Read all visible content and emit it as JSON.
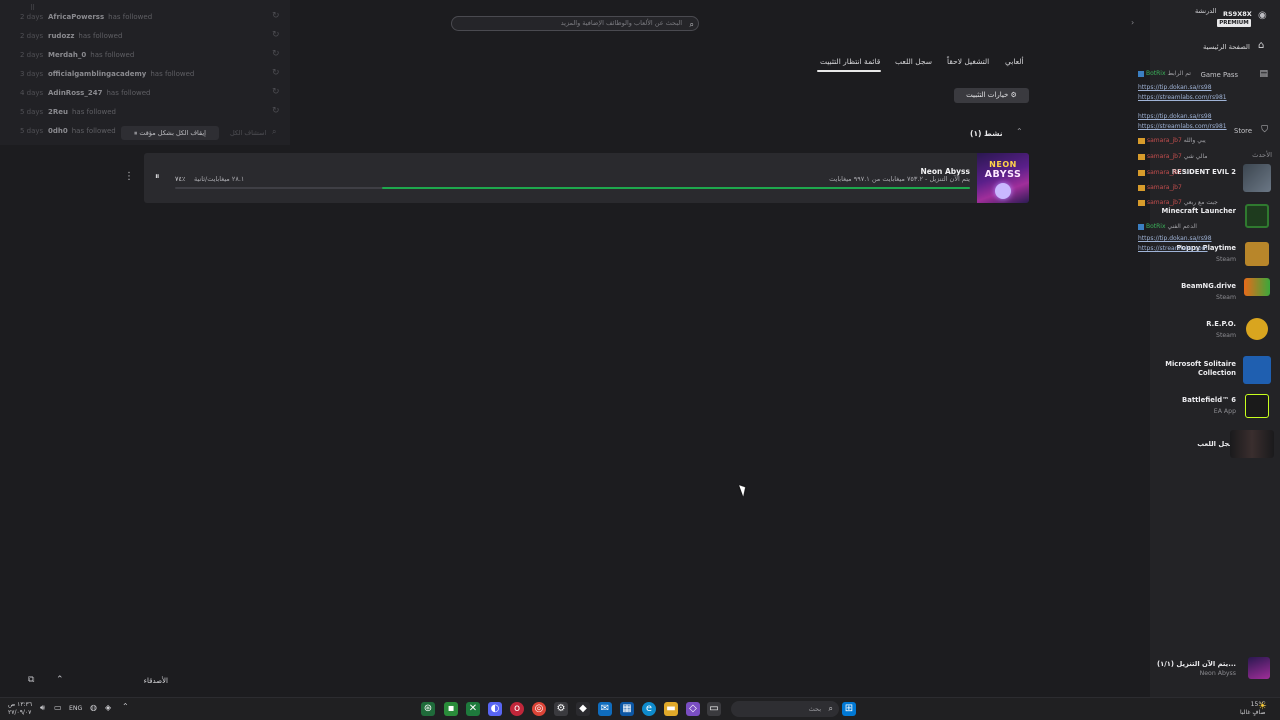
{
  "followers": {
    "rows": [
      {
        "ago": "2 days",
        "name": "AfricaPowerss",
        "action": "has followed"
      },
      {
        "ago": "2 days",
        "name": "rudozz",
        "action": "has followed"
      },
      {
        "ago": "2 days",
        "name": "Merdah_0",
        "action": "has followed"
      },
      {
        "ago": "3 days",
        "name": "officialgamblingacademy",
        "action": "has followed"
      },
      {
        "ago": "4 days",
        "name": "AdinRoss_247",
        "action": "has followed"
      },
      {
        "ago": "5 days",
        "name": "2Reu",
        "action": "has followed"
      },
      {
        "ago": "5 days",
        "name": "0dh0",
        "action": "has followed"
      }
    ],
    "pause_all": "⏸ إيقاف الكل بشكل مؤقت",
    "resume_all": "استئناف الكل"
  },
  "search": {
    "placeholder": "البحث عن الألعاب والوظائف الإضافية والمزيد"
  },
  "tabs": [
    {
      "label": "ألعابي"
    },
    {
      "label": "التشغيل لاحقاً"
    },
    {
      "label": "سجل اللعب"
    },
    {
      "label": "قائمة انتظار التثبيت",
      "active": true
    }
  ],
  "install_options": "خيارات التثبيت",
  "active_section": "نشط (١)",
  "download": {
    "art_line1": "NEON",
    "art_line2": "ABYSS",
    "title": "Neon Abyss",
    "status": "يتم الآن التنزيل - ٧٥٣.٢ ميغابايت من ٩٩٧.١ ميغابايت",
    "percent_label": "٧٤٪",
    "progress": 0.74,
    "speed": "٢٨.١ ميغابايت/ثانية"
  },
  "friends": {
    "label": "الأصدقاء"
  },
  "user": {
    "name": "الدرنشة",
    "tag": "RS9X8X",
    "badge": "PREMIUM",
    "home": "الصفحة الرئيسية"
  },
  "sidebar": {
    "nav": [
      {
        "label": "Game Pass"
      },
      {
        "label": "Store"
      },
      {
        "label": "الأحدث"
      }
    ],
    "games": [
      {
        "title": "RESIDENT EVIL 2",
        "sub": ""
      },
      {
        "title": "Minecraft Launcher",
        "sub": ""
      },
      {
        "title": "Poppy Playtime",
        "sub": "Steam"
      },
      {
        "title": "BeamNG.drive",
        "sub": "Steam"
      },
      {
        "title": "R.E.P.O.",
        "sub": "Steam"
      },
      {
        "title": "Microsoft Solitaire Collection",
        "sub": ""
      },
      {
        "title": "Battlefield™ 6",
        "sub": "EA App"
      },
      {
        "title": "سجل اللعب",
        "sub": ""
      }
    ],
    "downloading": {
      "title": "يتم الآن التنزيل (١/١)...",
      "sub": "Neon Abyss"
    }
  },
  "chat": {
    "lines": [
      {
        "user": "BotRix",
        "text": "تم الرابط",
        "bot": true
      },
      {
        "link": "https://tip.dokan.sa/rs98"
      },
      {
        "link": "https://streamlabs.com/rs981"
      },
      {
        "link": "https://tip.dokan.sa/rs98"
      },
      {
        "link": "https://streamlabs.com/rs981"
      },
      {
        "user": "samara_jb7",
        "text": "يبي والله"
      },
      {
        "user": "samara_jb7",
        "text": "مالي شي"
      },
      {
        "user": "samara_jb7",
        "text": "٦٧٠"
      },
      {
        "user": "samara_jb7",
        "text": ""
      },
      {
        "user": "samara_jb7",
        "text": "جبت مع ربعي"
      },
      {
        "user": "BotRix",
        "text": "الدعم الفني",
        "bot": true
      },
      {
        "link": "https://tip.dokan.sa/rs98"
      },
      {
        "link": "https://streamlabs.com"
      }
    ]
  },
  "taskbar": {
    "time": "١٣:٣٦ ص",
    "date": "٢٧/٠٩/٠٧",
    "lang": "ENG",
    "search": "بحث",
    "weather_temp": "15°C",
    "weather_desc": "صافٍ غالبا"
  }
}
